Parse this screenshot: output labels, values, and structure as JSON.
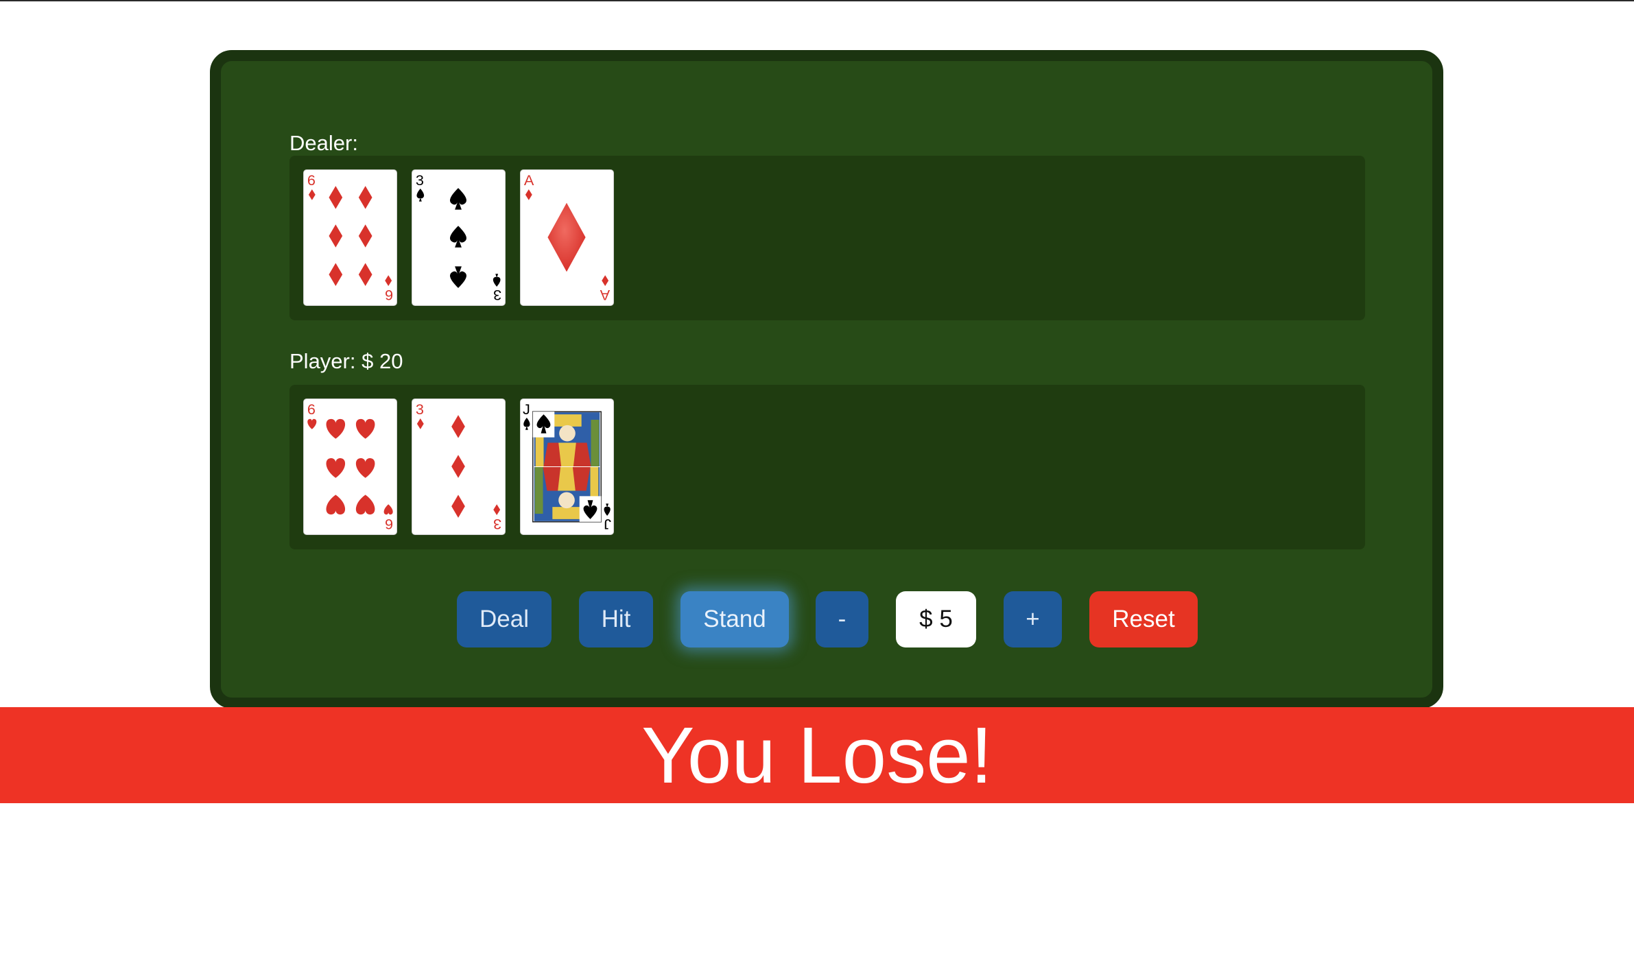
{
  "dealer": {
    "label": "Dealer:",
    "cards": [
      {
        "rank": "6",
        "suit": "diamonds",
        "color": "red"
      },
      {
        "rank": "3",
        "suit": "spades",
        "color": "black"
      },
      {
        "rank": "A",
        "suit": "diamonds",
        "color": "red"
      }
    ]
  },
  "player": {
    "label": "Player: $ 20",
    "cards": [
      {
        "rank": "6",
        "suit": "hearts",
        "color": "red"
      },
      {
        "rank": "3",
        "suit": "diamonds",
        "color": "red"
      },
      {
        "rank": "J",
        "suit": "spades",
        "color": "black"
      }
    ]
  },
  "controls": {
    "deal_label": "Deal",
    "hit_label": "Hit",
    "stand_label": "Stand",
    "minus_label": "-",
    "bet_value": "$ 5",
    "plus_label": "+",
    "reset_label": "Reset"
  },
  "result": {
    "message": "You Lose!"
  },
  "colors": {
    "felt": "#274b17",
    "felt_border": "#1b3410",
    "hand_area": "#1f3c10",
    "button_blue": "#1f5a9a",
    "button_highlight": "#3a83c4",
    "reset_red": "#e63423",
    "banner_red": "#ee3325",
    "card_red": "#d8322b",
    "card_black": "#000000"
  }
}
